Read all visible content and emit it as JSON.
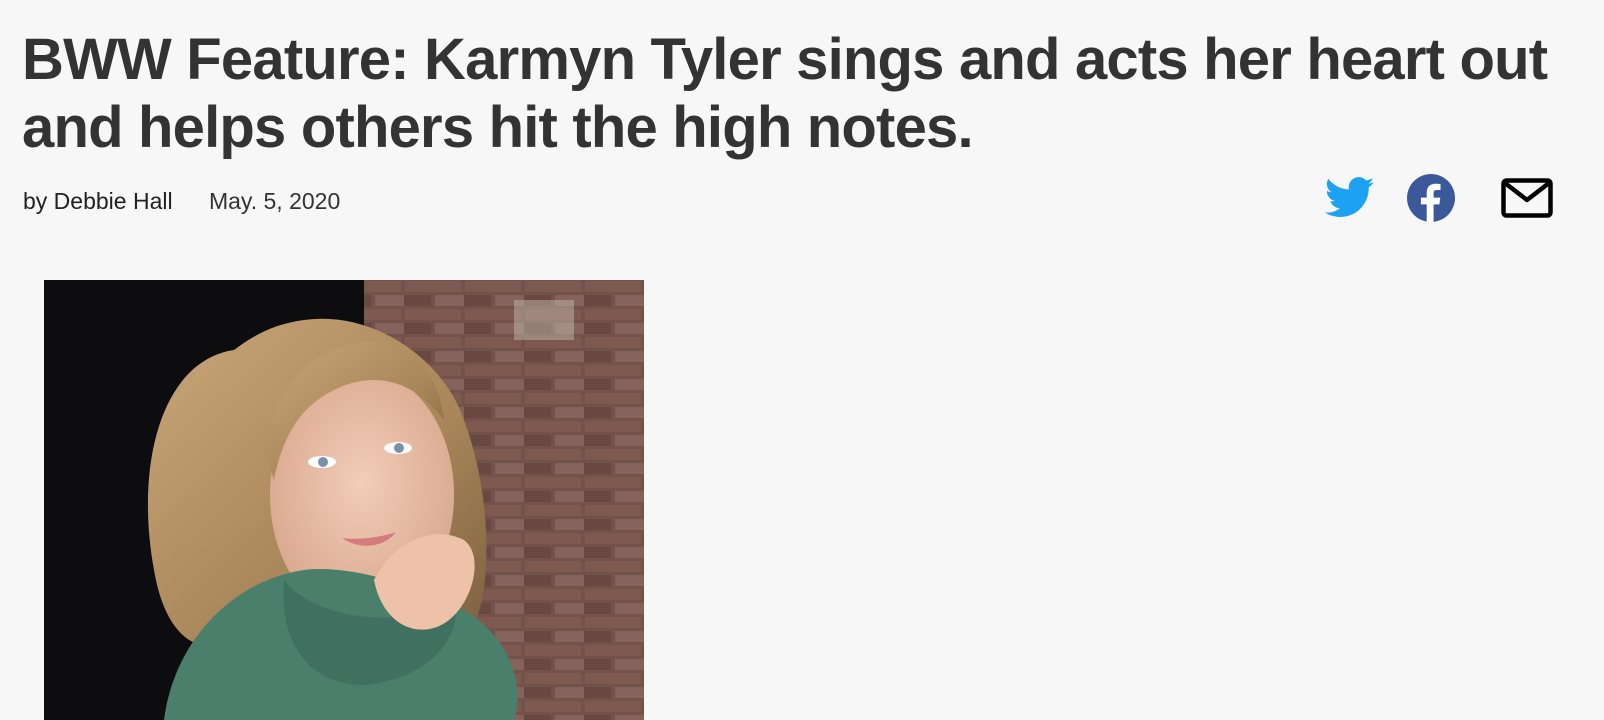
{
  "article": {
    "title": "BWW Feature: Karmyn Tyler sings and acts her heart out and helps others hit the high notes.",
    "byline": "by Debbie Hall",
    "date": "May. 5, 2020"
  },
  "share": {
    "twitter_icon": "twitter-bird-icon",
    "facebook_icon": "facebook-circle-icon",
    "email_icon": "envelope-icon",
    "colors": {
      "twitter": "#1da1f2",
      "facebook": "#3b5998",
      "email": "#000000"
    }
  },
  "photo": {
    "subject": "portrait-photo"
  }
}
